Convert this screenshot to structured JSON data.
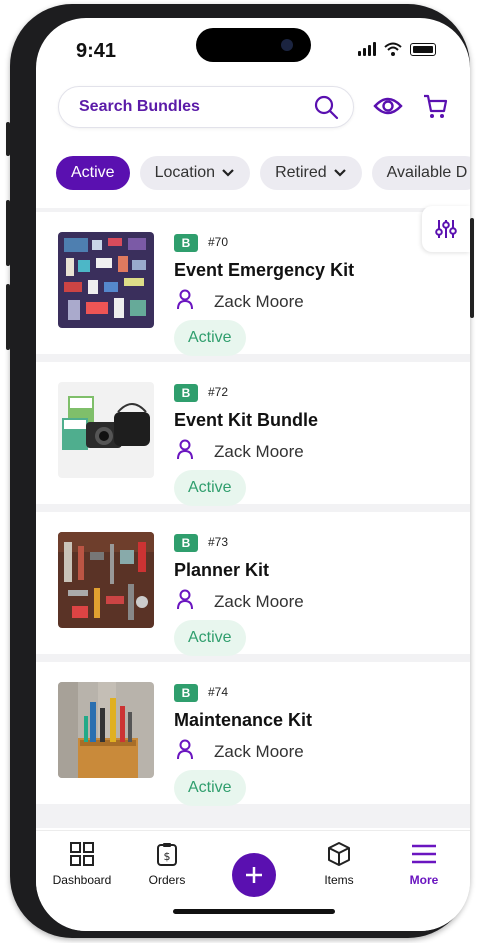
{
  "status_bar": {
    "time": "9:41"
  },
  "search": {
    "placeholder": "Search Bundles"
  },
  "filters": [
    {
      "label": "Active",
      "active": true
    },
    {
      "label": "Location",
      "dropdown": true
    },
    {
      "label": "Retired",
      "dropdown": true
    },
    {
      "label": "Available D",
      "dropdown": false
    }
  ],
  "bundles": [
    {
      "badge": "B",
      "number": "#70",
      "title": "Event Emergency Kit",
      "owner": "Zack Moore",
      "status": "Active",
      "image": "kit-flatlay"
    },
    {
      "badge": "B",
      "number": "#72",
      "title": "Event Kit Bundle",
      "owner": "Zack Moore",
      "status": "Active",
      "image": "instant-camera"
    },
    {
      "badge": "B",
      "number": "#73",
      "title": "Planner Kit",
      "owner": "Zack Moore",
      "status": "Active",
      "image": "tools-flatlay"
    },
    {
      "badge": "B",
      "number": "#74",
      "title": "Maintenance Kit",
      "owner": "Zack Moore",
      "status": "Active",
      "image": "toolbag"
    }
  ],
  "nav": {
    "dashboard": "Dashboard",
    "orders": "Orders",
    "items": "Items",
    "more": "More"
  },
  "colors": {
    "accent": "#5a10b0",
    "status_green": "#2f9e6d",
    "status_bg": "#e8f6ee"
  }
}
